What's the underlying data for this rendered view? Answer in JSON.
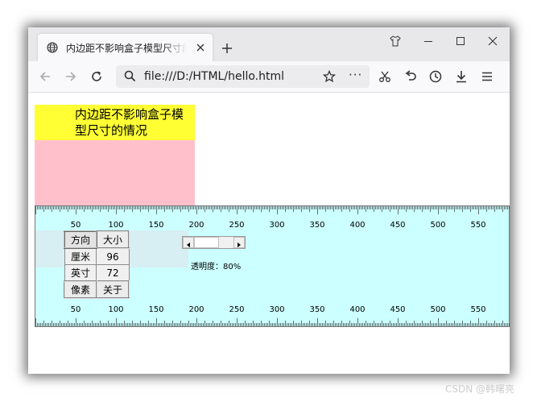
{
  "browser": {
    "tab_title": "内边距不影响盒子模型尺寸的情况",
    "url": "file:///D:/HTML/hello.html"
  },
  "page": {
    "box_text": "内边距不影响盒子模型尺寸的情况",
    "colors": {
      "box_bg": "#ffc0cb",
      "text_bg": "#ffff33",
      "ruler_bg": "#ccffff"
    }
  },
  "ruler": {
    "ticks_top": [
      "50",
      "100",
      "150",
      "200",
      "250",
      "300",
      "350",
      "400",
      "450",
      "500",
      "550"
    ],
    "ticks_bottom": [
      "50",
      "100",
      "150",
      "200",
      "250",
      "300",
      "350",
      "400",
      "450",
      "500",
      "550"
    ],
    "grid": [
      [
        "方向",
        "大小"
      ],
      [
        "厘米",
        "96"
      ],
      [
        "英寸",
        "72"
      ],
      [
        "像素",
        "关于"
      ]
    ],
    "opacity_label": "透明度：80%"
  },
  "watermark": "CSDN @韩曙亮",
  "icons": [
    "globe-icon",
    "close-icon",
    "plus-icon",
    "tshirt-icon",
    "minimize-icon",
    "maximize-icon",
    "window-close-icon",
    "back-icon",
    "forward-icon",
    "reload-icon",
    "search-icon",
    "star-icon",
    "more-icon",
    "scissors-icon",
    "undo-icon",
    "history-icon",
    "download-icon",
    "menu-icon"
  ]
}
